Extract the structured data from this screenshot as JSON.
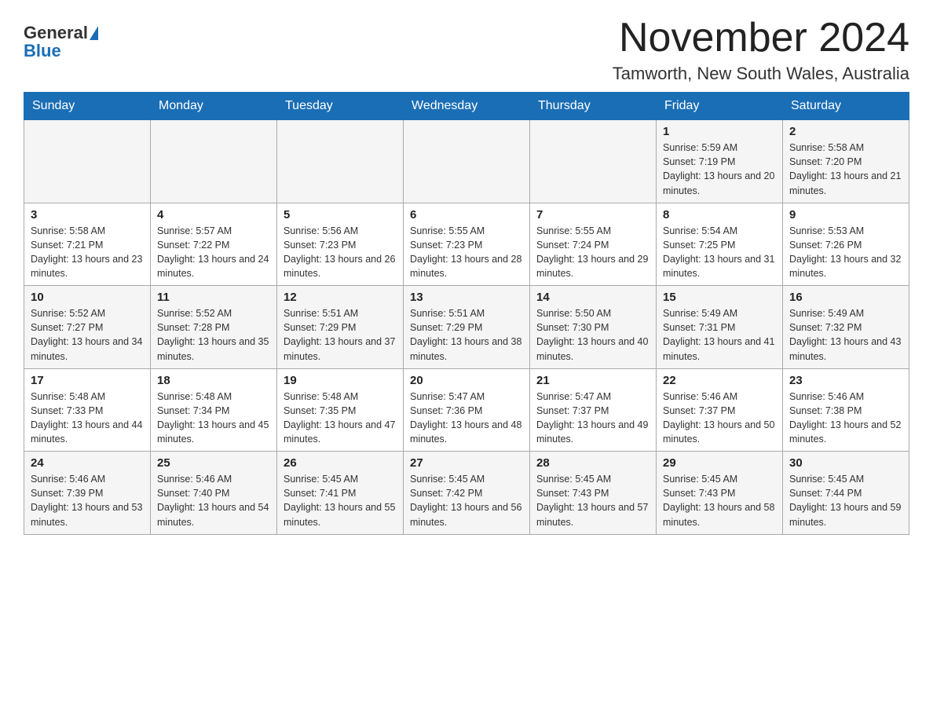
{
  "logo": {
    "line1": "General",
    "triangle": "▶",
    "line2": "Blue"
  },
  "title": {
    "month_year": "November 2024",
    "location": "Tamworth, New South Wales, Australia"
  },
  "days_of_week": [
    "Sunday",
    "Monday",
    "Tuesday",
    "Wednesday",
    "Thursday",
    "Friday",
    "Saturday"
  ],
  "weeks": [
    [
      {
        "day": "",
        "sunrise": "",
        "sunset": "",
        "daylight": ""
      },
      {
        "day": "",
        "sunrise": "",
        "sunset": "",
        "daylight": ""
      },
      {
        "day": "",
        "sunrise": "",
        "sunset": "",
        "daylight": ""
      },
      {
        "day": "",
        "sunrise": "",
        "sunset": "",
        "daylight": ""
      },
      {
        "day": "",
        "sunrise": "",
        "sunset": "",
        "daylight": ""
      },
      {
        "day": "1",
        "sunrise": "Sunrise: 5:59 AM",
        "sunset": "Sunset: 7:19 PM",
        "daylight": "Daylight: 13 hours and 20 minutes."
      },
      {
        "day": "2",
        "sunrise": "Sunrise: 5:58 AM",
        "sunset": "Sunset: 7:20 PM",
        "daylight": "Daylight: 13 hours and 21 minutes."
      }
    ],
    [
      {
        "day": "3",
        "sunrise": "Sunrise: 5:58 AM",
        "sunset": "Sunset: 7:21 PM",
        "daylight": "Daylight: 13 hours and 23 minutes."
      },
      {
        "day": "4",
        "sunrise": "Sunrise: 5:57 AM",
        "sunset": "Sunset: 7:22 PM",
        "daylight": "Daylight: 13 hours and 24 minutes."
      },
      {
        "day": "5",
        "sunrise": "Sunrise: 5:56 AM",
        "sunset": "Sunset: 7:23 PM",
        "daylight": "Daylight: 13 hours and 26 minutes."
      },
      {
        "day": "6",
        "sunrise": "Sunrise: 5:55 AM",
        "sunset": "Sunset: 7:23 PM",
        "daylight": "Daylight: 13 hours and 28 minutes."
      },
      {
        "day": "7",
        "sunrise": "Sunrise: 5:55 AM",
        "sunset": "Sunset: 7:24 PM",
        "daylight": "Daylight: 13 hours and 29 minutes."
      },
      {
        "day": "8",
        "sunrise": "Sunrise: 5:54 AM",
        "sunset": "Sunset: 7:25 PM",
        "daylight": "Daylight: 13 hours and 31 minutes."
      },
      {
        "day": "9",
        "sunrise": "Sunrise: 5:53 AM",
        "sunset": "Sunset: 7:26 PM",
        "daylight": "Daylight: 13 hours and 32 minutes."
      }
    ],
    [
      {
        "day": "10",
        "sunrise": "Sunrise: 5:52 AM",
        "sunset": "Sunset: 7:27 PM",
        "daylight": "Daylight: 13 hours and 34 minutes."
      },
      {
        "day": "11",
        "sunrise": "Sunrise: 5:52 AM",
        "sunset": "Sunset: 7:28 PM",
        "daylight": "Daylight: 13 hours and 35 minutes."
      },
      {
        "day": "12",
        "sunrise": "Sunrise: 5:51 AM",
        "sunset": "Sunset: 7:29 PM",
        "daylight": "Daylight: 13 hours and 37 minutes."
      },
      {
        "day": "13",
        "sunrise": "Sunrise: 5:51 AM",
        "sunset": "Sunset: 7:29 PM",
        "daylight": "Daylight: 13 hours and 38 minutes."
      },
      {
        "day": "14",
        "sunrise": "Sunrise: 5:50 AM",
        "sunset": "Sunset: 7:30 PM",
        "daylight": "Daylight: 13 hours and 40 minutes."
      },
      {
        "day": "15",
        "sunrise": "Sunrise: 5:49 AM",
        "sunset": "Sunset: 7:31 PM",
        "daylight": "Daylight: 13 hours and 41 minutes."
      },
      {
        "day": "16",
        "sunrise": "Sunrise: 5:49 AM",
        "sunset": "Sunset: 7:32 PM",
        "daylight": "Daylight: 13 hours and 43 minutes."
      }
    ],
    [
      {
        "day": "17",
        "sunrise": "Sunrise: 5:48 AM",
        "sunset": "Sunset: 7:33 PM",
        "daylight": "Daylight: 13 hours and 44 minutes."
      },
      {
        "day": "18",
        "sunrise": "Sunrise: 5:48 AM",
        "sunset": "Sunset: 7:34 PM",
        "daylight": "Daylight: 13 hours and 45 minutes."
      },
      {
        "day": "19",
        "sunrise": "Sunrise: 5:48 AM",
        "sunset": "Sunset: 7:35 PM",
        "daylight": "Daylight: 13 hours and 47 minutes."
      },
      {
        "day": "20",
        "sunrise": "Sunrise: 5:47 AM",
        "sunset": "Sunset: 7:36 PM",
        "daylight": "Daylight: 13 hours and 48 minutes."
      },
      {
        "day": "21",
        "sunrise": "Sunrise: 5:47 AM",
        "sunset": "Sunset: 7:37 PM",
        "daylight": "Daylight: 13 hours and 49 minutes."
      },
      {
        "day": "22",
        "sunrise": "Sunrise: 5:46 AM",
        "sunset": "Sunset: 7:37 PM",
        "daylight": "Daylight: 13 hours and 50 minutes."
      },
      {
        "day": "23",
        "sunrise": "Sunrise: 5:46 AM",
        "sunset": "Sunset: 7:38 PM",
        "daylight": "Daylight: 13 hours and 52 minutes."
      }
    ],
    [
      {
        "day": "24",
        "sunrise": "Sunrise: 5:46 AM",
        "sunset": "Sunset: 7:39 PM",
        "daylight": "Daylight: 13 hours and 53 minutes."
      },
      {
        "day": "25",
        "sunrise": "Sunrise: 5:46 AM",
        "sunset": "Sunset: 7:40 PM",
        "daylight": "Daylight: 13 hours and 54 minutes."
      },
      {
        "day": "26",
        "sunrise": "Sunrise: 5:45 AM",
        "sunset": "Sunset: 7:41 PM",
        "daylight": "Daylight: 13 hours and 55 minutes."
      },
      {
        "day": "27",
        "sunrise": "Sunrise: 5:45 AM",
        "sunset": "Sunset: 7:42 PM",
        "daylight": "Daylight: 13 hours and 56 minutes."
      },
      {
        "day": "28",
        "sunrise": "Sunrise: 5:45 AM",
        "sunset": "Sunset: 7:43 PM",
        "daylight": "Daylight: 13 hours and 57 minutes."
      },
      {
        "day": "29",
        "sunrise": "Sunrise: 5:45 AM",
        "sunset": "Sunset: 7:43 PM",
        "daylight": "Daylight: 13 hours and 58 minutes."
      },
      {
        "day": "30",
        "sunrise": "Sunrise: 5:45 AM",
        "sunset": "Sunset: 7:44 PM",
        "daylight": "Daylight: 13 hours and 59 minutes."
      }
    ]
  ]
}
